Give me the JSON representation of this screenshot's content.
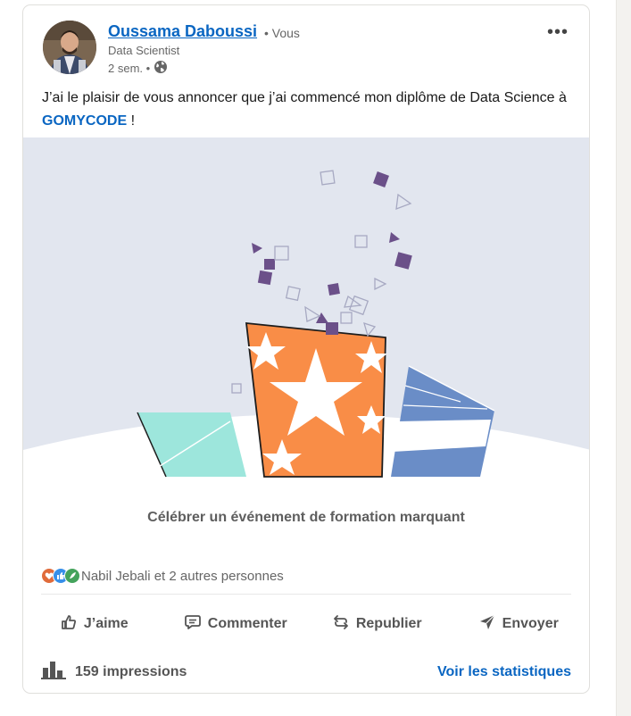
{
  "post": {
    "author_name": "Oussama Daboussi",
    "you_badge": "• Vous",
    "headline": "Data Scientist",
    "time": "2 sem. •",
    "text_before": "J’ai le plaisir de vous annoncer que j’ai commencé mon diplôme de Data Science à ",
    "mention": "GOMYCODE",
    "text_after": " !"
  },
  "celebration": {
    "caption": "Célébrer un événement de formation marquant"
  },
  "social": {
    "reactors": "Nabil Jebali et 2 autres personnes",
    "reaction_icons": [
      "love-reaction-icon",
      "like-reaction-icon",
      "insightful-reaction-icon"
    ]
  },
  "actions": {
    "like": "J’aime",
    "comment": "Commenter",
    "repost": "Republier",
    "send": "Envoyer"
  },
  "stats": {
    "impressions": "159 impressions",
    "view_stats": "Voir les statistiques"
  },
  "colors": {
    "brand_blue": "#0a66c2",
    "illustration_bg": "#e2e6ef",
    "gift_orange": "#f98d47",
    "gift_teal": "#9de6dc",
    "gift_blue": "#6a8dc7",
    "confetti_purple": "#6b5089"
  }
}
